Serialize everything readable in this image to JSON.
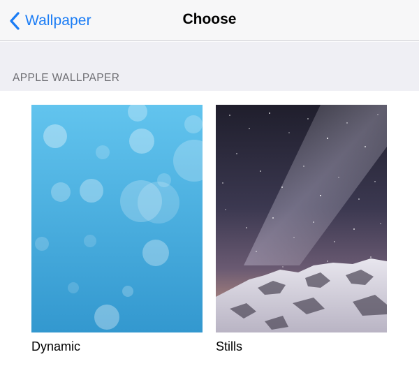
{
  "nav": {
    "back_label": "Wallpaper",
    "title": "Choose"
  },
  "section": {
    "header": "APPLE WALLPAPER"
  },
  "wallpapers": [
    {
      "label": "Dynamic"
    },
    {
      "label": "Stills"
    }
  ],
  "colors": {
    "accent": "#1a7cf5",
    "nav_background": "#f7f7f8",
    "group_background": "#efeff4",
    "section_header_text": "#6d6d72"
  },
  "icons": {
    "back": "chevron-left-icon"
  }
}
